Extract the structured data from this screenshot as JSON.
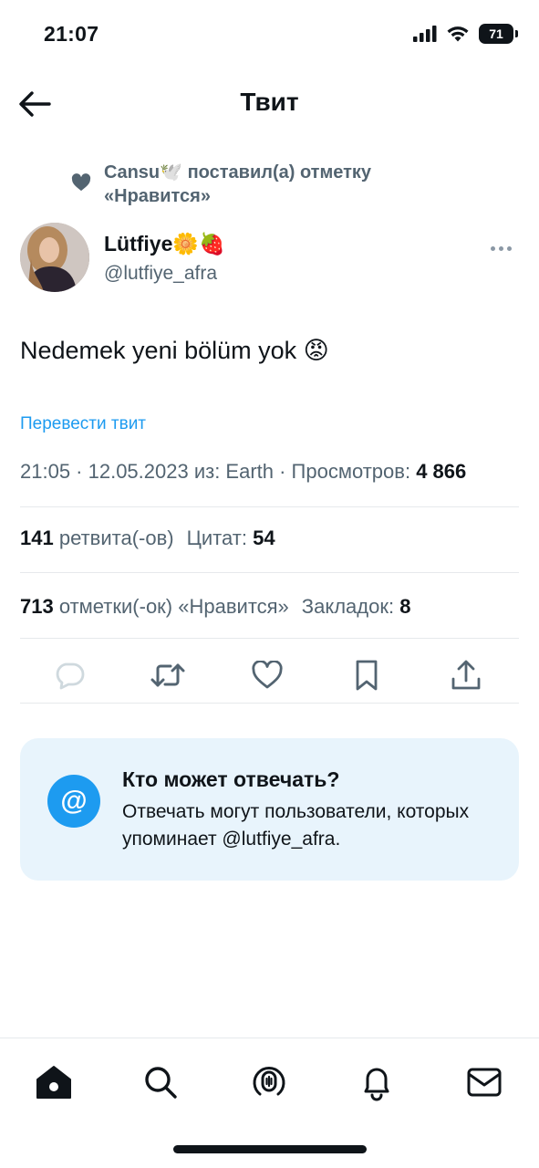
{
  "status_bar": {
    "time": "21:07",
    "battery": "71"
  },
  "header": {
    "title": "Твит"
  },
  "social_context": {
    "text": "Cansu🕊️ поставил(а) отметку «Нравится»"
  },
  "author": {
    "display_name": "Lütfiye🌼🍓",
    "handle": "@lutfiye_afra"
  },
  "tweet": {
    "text": "Nedemek yeni bölüm yok 😡",
    "translate_label": "Перевести твит",
    "meta_prefix": "21:05 · 12.05.2023 из: Earth · Просмотров:",
    "views": "4 866"
  },
  "stats": {
    "retweets": {
      "count": "141",
      "label": "ретвита(-ов)"
    },
    "quotes": {
      "label": "Цитат:",
      "count": "54"
    },
    "likes": {
      "count": "713",
      "label": "отметки(-ок) «Нравится»"
    },
    "bookmarks": {
      "label": "Закладок:",
      "count": "8"
    }
  },
  "actions": [
    "reply-icon",
    "retweet-icon",
    "like-icon",
    "bookmark-icon",
    "share-icon"
  ],
  "reply_restriction": {
    "title": "Кто может отвечать?",
    "description": "Отвечать могут пользователи, которых упоминает @lutfiye_afra.",
    "icon": "@"
  },
  "tabbar": [
    "home-icon",
    "search-icon",
    "spaces-icon",
    "notifications-icon",
    "messages-icon"
  ],
  "colors": {
    "accent": "#1d9bf0",
    "secondary_text": "#536471",
    "card_bg": "#e8f4fc"
  }
}
